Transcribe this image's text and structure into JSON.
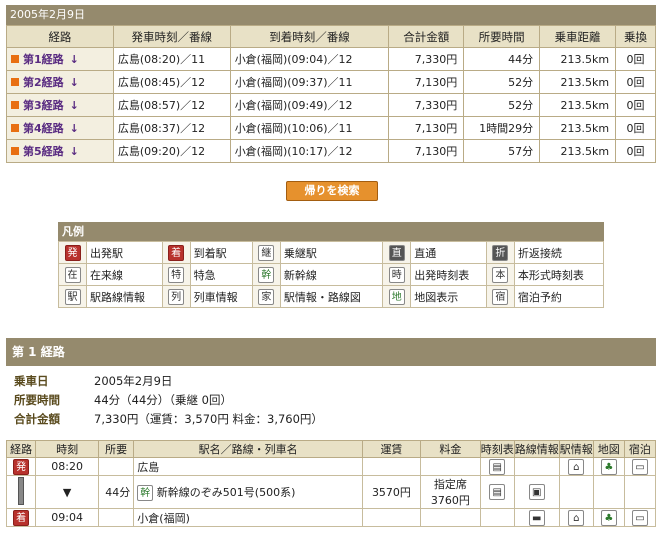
{
  "date_header": "2005年2月9日",
  "routes_table": {
    "headers": [
      "経路",
      "発車時刻／番線",
      "到着時刻／番線",
      "合計金額",
      "所要時間",
      "乗車距離",
      "乗換"
    ],
    "rows": [
      {
        "label": "第1経路",
        "dep": "広島(08:20)／11",
        "arr": "小倉(福岡)(09:04)／12",
        "fare": "7,330円",
        "time": "44分",
        "dist": "213.5km",
        "transfers": "0回"
      },
      {
        "label": "第2経路",
        "dep": "広島(08:45)／12",
        "arr": "小倉(福岡)(09:37)／11",
        "fare": "7,130円",
        "time": "52分",
        "dist": "213.5km",
        "transfers": "0回"
      },
      {
        "label": "第3経路",
        "dep": "広島(08:57)／12",
        "arr": "小倉(福岡)(09:49)／12",
        "fare": "7,330円",
        "time": "52分",
        "dist": "213.5km",
        "transfers": "0回"
      },
      {
        "label": "第4経路",
        "dep": "広島(08:37)／12",
        "arr": "小倉(福岡)(10:06)／11",
        "fare": "7,130円",
        "time": "1時間29分",
        "dist": "213.5km",
        "transfers": "0回"
      },
      {
        "label": "第5経路",
        "dep": "広島(09:20)／12",
        "arr": "小倉(福岡)(10:17)／12",
        "fare": "7,130円",
        "time": "57分",
        "dist": "213.5km",
        "transfers": "0回"
      }
    ],
    "arrow": "↓"
  },
  "return_button": "帰りを検索",
  "legend": {
    "title": "凡例",
    "items": [
      {
        "icon": "発",
        "label": "出発駅"
      },
      {
        "icon": "着",
        "label": "到着駅"
      },
      {
        "icon": "継",
        "label": "乗継駅"
      },
      {
        "icon": "直",
        "label": "直通"
      },
      {
        "icon": "折",
        "label": "折返接続"
      },
      {
        "icon": "在",
        "label": "在来線"
      },
      {
        "icon": "特",
        "label": "特急"
      },
      {
        "icon": "幹",
        "label": "新幹線"
      },
      {
        "icon": "時",
        "label": "出発時刻表"
      },
      {
        "icon": "本",
        "label": "本形式時刻表"
      },
      {
        "icon": "駅",
        "label": "駅路線情報"
      },
      {
        "icon": "列",
        "label": "列車情報"
      },
      {
        "icon": "家",
        "label": "駅情報・路線図"
      },
      {
        "icon": "地",
        "label": "地図表示"
      },
      {
        "icon": "宿",
        "label": "宿泊予約"
      }
    ]
  },
  "route_section": {
    "title": "第 1 経路",
    "summary": [
      {
        "key": "乗車日",
        "value": "2005年2月9日"
      },
      {
        "key": "所要時間",
        "value": "44分（44分）（乗継 0回）"
      },
      {
        "key": "合計金額",
        "value": "7,330円（運賃：3,570円  料金：3,760円）"
      }
    ],
    "detail_headers": [
      "経路",
      "時刻",
      "所要",
      "駅名／路線・列車名",
      "運賃",
      "料金",
      "時刻表",
      "路線情報",
      "駅情報",
      "地図",
      "宿泊"
    ],
    "departure": {
      "badge": "発",
      "time": "08:20",
      "station": "広島"
    },
    "train": {
      "arrow": "▼",
      "duration": "44分",
      "line_badge": "幹",
      "name": "新幹線のぞみ501号(500系)",
      "fare": "3570円",
      "fee_type": "指定席",
      "fee": "3760円"
    },
    "arrival": {
      "badge": "着",
      "time": "09:04",
      "station": "小倉(福岡)"
    }
  },
  "colors": {
    "header_bg": "#958a6d",
    "cell_bg": "#e8e1c6",
    "accent": "#e86f12",
    "route_text": "#5a2c82"
  }
}
